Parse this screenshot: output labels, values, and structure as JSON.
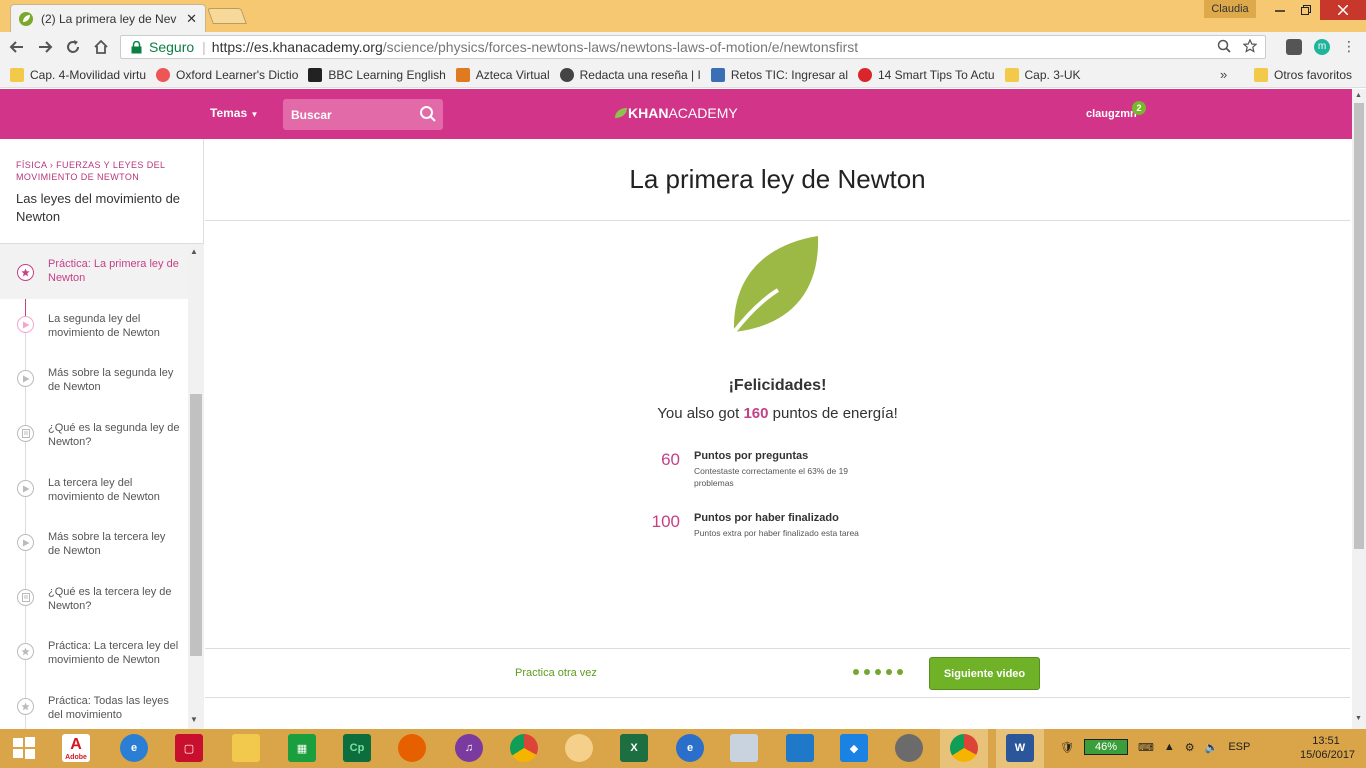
{
  "browser": {
    "tab_title": "(2) La primera ley de Nev",
    "tab_close": "✕",
    "window_user": "Claudia",
    "url_secure_label": "Seguro",
    "url_host": "https://es.khanacademy.org",
    "url_path": "/science/physics/forces-newtons-laws/newtons-laws-of-motion/e/newtonsfirst",
    "ext_m_label": "m",
    "bookmarks": [
      "Cap. 4-Movilidad virtu",
      "Oxford Learner's Dictio",
      "BBC Learning English",
      "Azteca Virtual",
      "Redacta una reseña | I",
      "Retos TIC: Ingresar al",
      "14 Smart Tips To Actu",
      "Cap. 3-UK"
    ],
    "bookmarks_more": "»",
    "other_bookmarks": "Otros favoritos"
  },
  "header": {
    "topics": "Temas",
    "search_placeholder": "Buscar",
    "logo_bold": "KHAN",
    "logo_light": "ACADEMY",
    "username": "claugzmn",
    "notifications": "2"
  },
  "sidebar": {
    "crumb_subject": "FÍSICA",
    "crumb_sep": "›",
    "crumb_topic": "FUERZAS Y LEYES DEL MOVIMIENTO DE NEWTON",
    "section_title": "Las leyes del movimiento de Newton",
    "items": [
      {
        "label": "Práctica: La primera ley de Newton",
        "kind": "star-icon",
        "active": true
      },
      {
        "label": "La segunda ley del movimiento de Newton",
        "kind": "play-icon",
        "active": false
      },
      {
        "label": "Más sobre la segunda ley de Newton",
        "kind": "play-icon",
        "active": false
      },
      {
        "label": "¿Qué es la segunda ley de Newton?",
        "kind": "article-icon",
        "active": false
      },
      {
        "label": "La tercera ley del movimiento de Newton",
        "kind": "play-icon",
        "active": false
      },
      {
        "label": "Más sobre la tercera ley de Newton",
        "kind": "play-icon",
        "active": false
      },
      {
        "label": "¿Qué es la tercera ley de Newton?",
        "kind": "article-icon",
        "active": false
      },
      {
        "label": "Práctica: La tercera ley del movimiento de Newton",
        "kind": "star-icon",
        "active": false
      },
      {
        "label": "Práctica: Todas las leyes del movimiento",
        "kind": "star-icon",
        "active": false
      }
    ]
  },
  "main": {
    "title": "La primera ley de Newton",
    "congrats": "¡Felicidades!",
    "energy_prefix": "You also got",
    "energy_points": "160",
    "energy_suffix": "puntos de energía!",
    "points": [
      {
        "value": "60",
        "label": "Puntos por preguntas",
        "detail": "Contestaste correctamente el 63% de 19 problemas"
      },
      {
        "value": "100",
        "label": "Puntos por haber finalizado",
        "detail": "Puntos extra por haber finalizado esta tarea"
      }
    ],
    "practice_again": "Practica otra vez",
    "next_button": "Siguiente video",
    "progress_dots": 5
  },
  "taskbar": {
    "battery": "46%",
    "language": "ESP",
    "time": "13:51",
    "date": "15/06/2017",
    "adobe_label": "Adobe",
    "cp_label": "Cp"
  },
  "colors": {
    "ka_pink": "#d13488",
    "ka_green": "#6fb227",
    "taskbar": "#d9a548",
    "titlebar": "#f6c872"
  }
}
